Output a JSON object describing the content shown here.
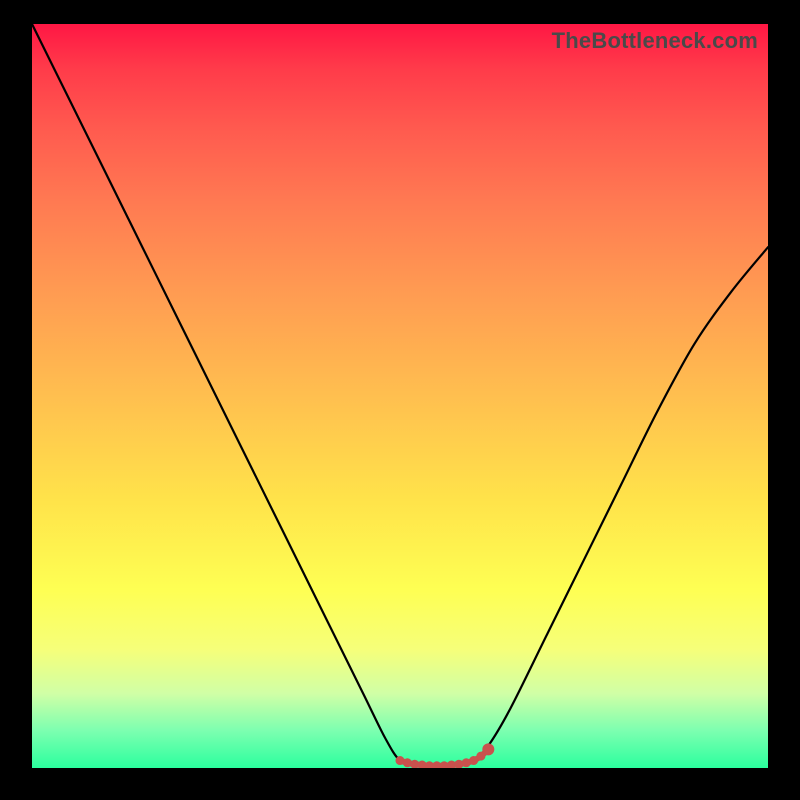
{
  "watermark": "TheBottleneck.com",
  "colors": {
    "curve_stroke": "#000000",
    "marker_stroke": "#c9514d",
    "marker_fill": "#c9514d",
    "background_black": "#000000"
  },
  "chart_data": {
    "type": "line",
    "title": "",
    "xlabel": "",
    "ylabel": "",
    "xlim": [
      0,
      100
    ],
    "ylim": [
      0,
      100
    ],
    "grid": false,
    "series": [
      {
        "name": "bottleneck-curve",
        "x": [
          0,
          5,
          10,
          15,
          20,
          25,
          30,
          35,
          40,
          45,
          48,
          50,
          52,
          54,
          56,
          58,
          60,
          62,
          65,
          70,
          75,
          80,
          85,
          90,
          95,
          100
        ],
        "y": [
          100,
          90,
          80,
          70,
          60,
          50,
          40,
          30,
          20,
          10,
          4,
          1,
          0.5,
          0.3,
          0.3,
          0.5,
          1,
          3,
          8,
          18,
          28,
          38,
          48,
          57,
          64,
          70
        ]
      }
    ],
    "markers": {
      "name": "minimum-band",
      "x": [
        50,
        51,
        52,
        53,
        54,
        55,
        56,
        57,
        58,
        59,
        60,
        61,
        62
      ],
      "y": [
        1.0,
        0.7,
        0.5,
        0.4,
        0.3,
        0.3,
        0.3,
        0.4,
        0.5,
        0.7,
        1.0,
        1.6,
        2.5
      ]
    }
  }
}
